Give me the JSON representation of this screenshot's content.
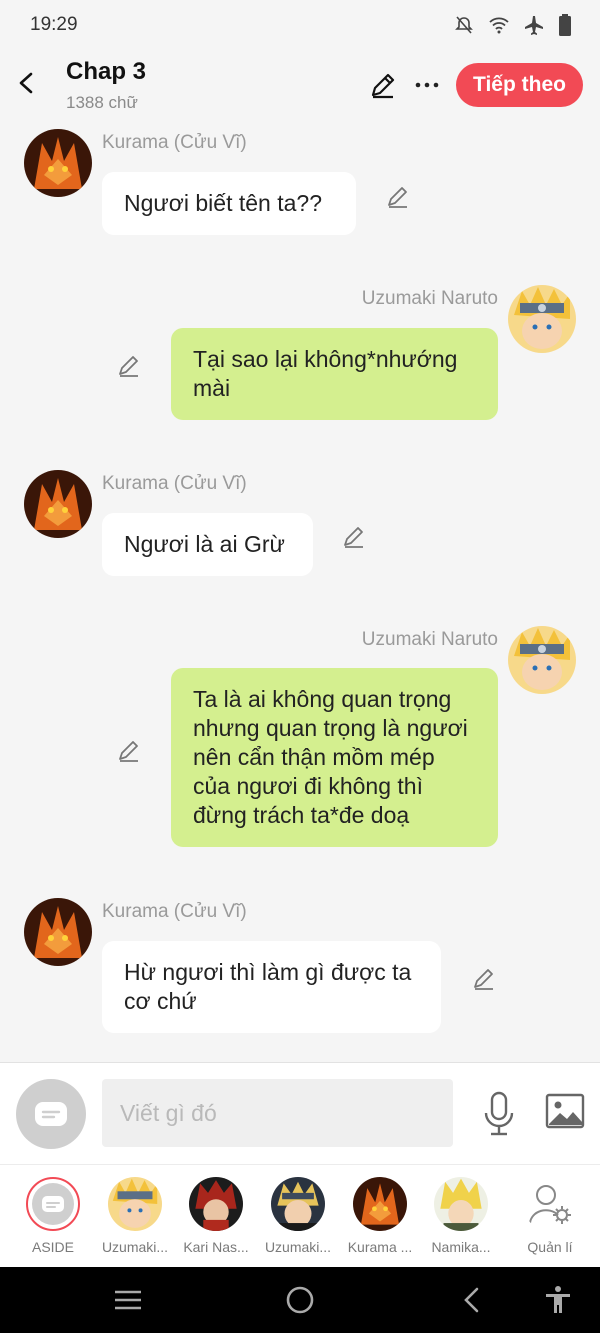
{
  "status": {
    "time": "19:29"
  },
  "header": {
    "title": "Chap 3",
    "word_count": "1388 chữ",
    "next_label": "Tiếp theo"
  },
  "messages": [
    {
      "sender": "Kurama (Cửu Vĩ)",
      "text": "Ngươi biết tên ta??",
      "side": "left"
    },
    {
      "sender": "Uzumaki Naruto",
      "text": "Tại sao lại không*nhướng mài",
      "side": "right"
    },
    {
      "sender": "Kurama (Cửu Vĩ)",
      "text": "Ngươi là ai Grừ",
      "side": "left"
    },
    {
      "sender": "Uzumaki Naruto",
      "text": "Ta là ai không quan trọng nhưng quan trọng là ngươi nên cẩn thận mồm mép của ngươi đi không thì đừng trách ta*đe doạ",
      "side": "right"
    },
    {
      "sender": "Kurama (Cửu Vĩ)",
      "text": "Hừ ngươi thì làm gì được ta cơ chứ",
      "side": "left"
    }
  ],
  "input": {
    "placeholder": "Viết gì đó"
  },
  "characters": [
    {
      "label": "ASIDE",
      "icon": "aside-icon"
    },
    {
      "label": "Uzumaki...",
      "icon": "naruto-avatar"
    },
    {
      "label": "Kari Nas...",
      "icon": "kari-avatar"
    },
    {
      "label": "Uzumaki...",
      "icon": "boruto-avatar"
    },
    {
      "label": "Kurama ...",
      "icon": "kurama-avatar"
    },
    {
      "label": "Namika...",
      "icon": "minato-avatar"
    },
    {
      "label": "Quản lí",
      "icon": "manage-icon"
    }
  ],
  "colors": {
    "accent": "#f24a55",
    "right_bubble": "#d4ef8f",
    "left_bubble": "#ffffff",
    "background": "#f5f5f5"
  }
}
